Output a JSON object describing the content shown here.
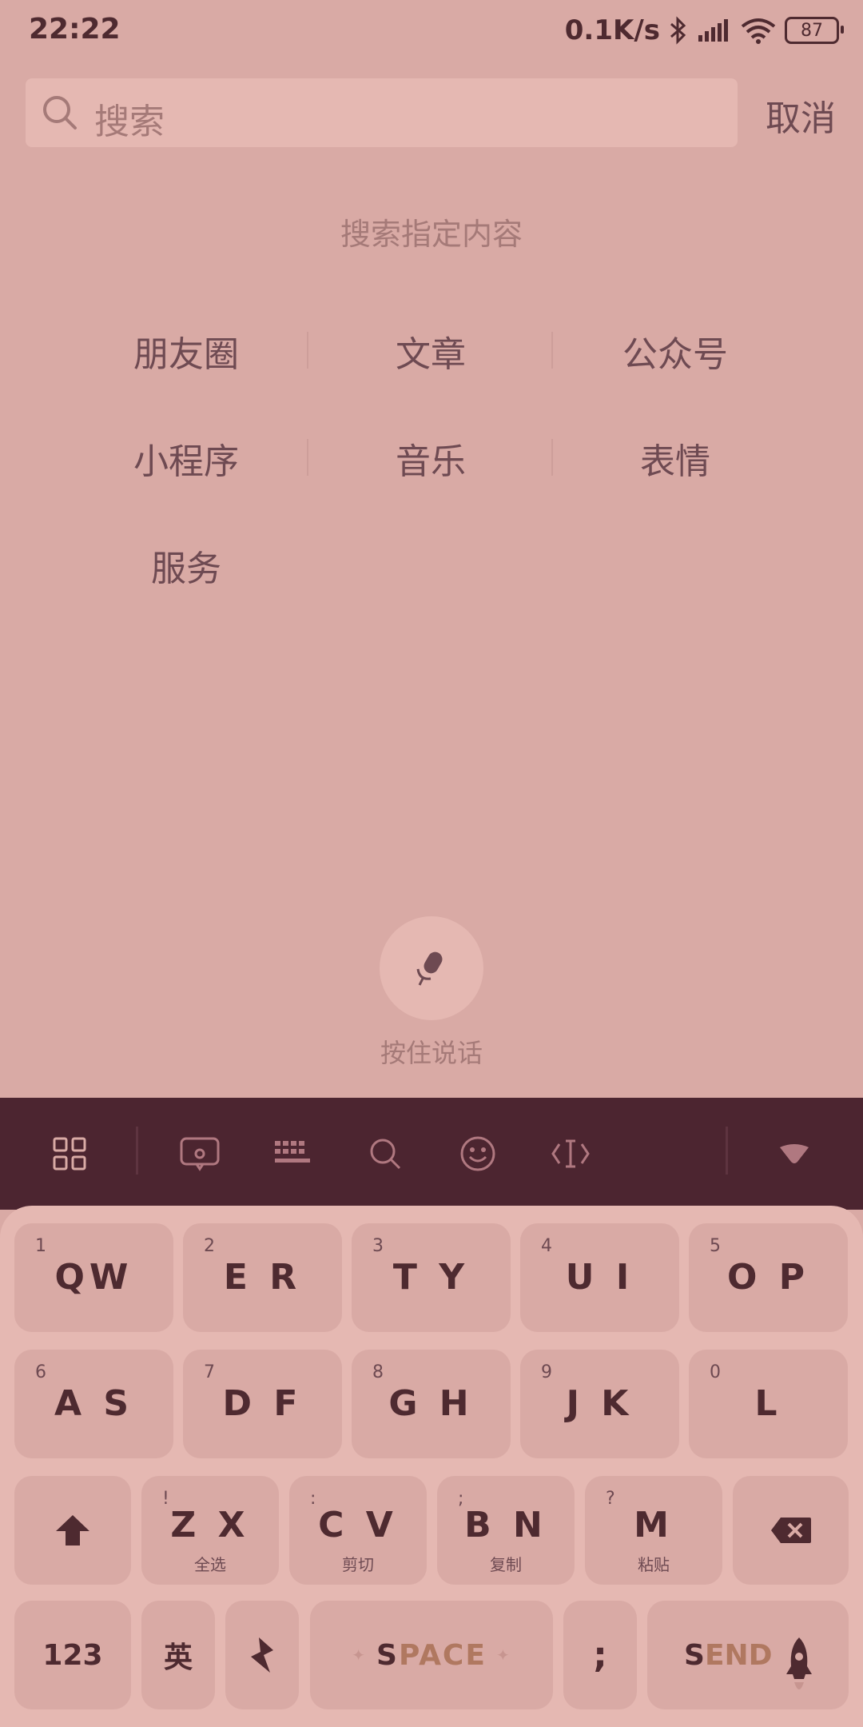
{
  "status": {
    "time": "22:22",
    "network_speed": "0.1K/s",
    "battery": "87"
  },
  "search": {
    "placeholder": "搜索",
    "cancel_label": "取消"
  },
  "section": {
    "title": "搜索指定内容"
  },
  "categories": [
    [
      "朋友圈",
      "文章",
      "公众号"
    ],
    [
      "小程序",
      "音乐",
      "表情"
    ],
    [
      "服务"
    ]
  ],
  "voice": {
    "label": "按住说话"
  },
  "keyboard": {
    "toolbar_icons": [
      "apps-grid-icon",
      "sticker-icon",
      "keyboard-icon",
      "search-icon",
      "emoji-icon",
      "cursor-icon",
      "collapse-icon"
    ],
    "row1": [
      {
        "num": "1",
        "label": "QW"
      },
      {
        "num": "2",
        "label": "E R"
      },
      {
        "num": "3",
        "label": "T Y"
      },
      {
        "num": "4",
        "label": "U I"
      },
      {
        "num": "5",
        "label": "O P"
      }
    ],
    "row2": [
      {
        "num": "6",
        "label": "A S"
      },
      {
        "num": "7",
        "label": "D F"
      },
      {
        "num": "8",
        "label": "G H"
      },
      {
        "num": "9",
        "label": "J K"
      },
      {
        "num": "0",
        "label": "L"
      }
    ],
    "row3": [
      {
        "num": "!",
        "label": "Z X",
        "sub": "全选"
      },
      {
        "num": ":",
        "label": "C V",
        "sub": "剪切"
      },
      {
        "num": ";",
        "label": "B N",
        "sub": "复制"
      },
      {
        "num": "?",
        "label": "M",
        "sub": "粘贴"
      }
    ],
    "row4": {
      "numbers": "123",
      "lang": "英",
      "space_a": "S",
      "space_b": "PACE",
      "semicolon": ";",
      "send_a": "S",
      "send_b": "END"
    }
  },
  "colors": {
    "background": "#d9aaa5",
    "toolbar": "#4c2530",
    "text_dark": "#4e2a30",
    "accent": "#b07860"
  }
}
